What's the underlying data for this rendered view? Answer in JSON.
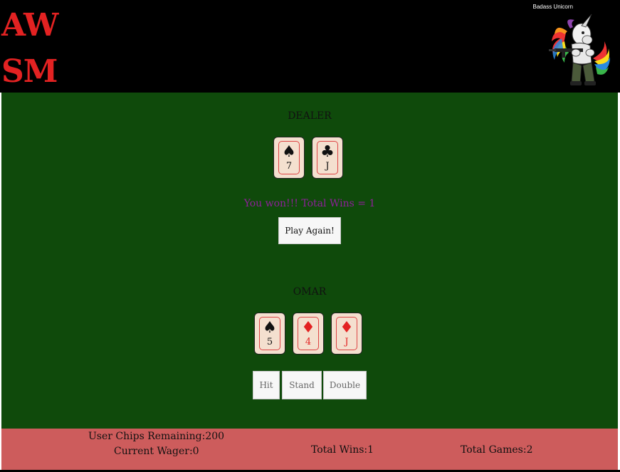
{
  "header": {
    "logo_line1": "AW",
    "logo_line2": "SM",
    "mascot_caption": "Badass Unicorn"
  },
  "dealer": {
    "label": "DEALER",
    "cards": [
      {
        "suit": "♠",
        "rank": "7",
        "color": "black"
      },
      {
        "suit": "♣",
        "rank": "J",
        "color": "black"
      }
    ]
  },
  "result": {
    "message": "You won!!! Total Wins = 1",
    "play_again_label": "Play Again!"
  },
  "player": {
    "label": "OMAR",
    "cards": [
      {
        "suit": "♠",
        "rank": "5",
        "color": "black"
      },
      {
        "suit": "♦",
        "rank": "4",
        "color": "red"
      },
      {
        "suit": "♦",
        "rank": "J",
        "color": "red"
      }
    ]
  },
  "actions": {
    "hit_label": "Hit",
    "stand_label": "Stand",
    "double_label": "Double"
  },
  "footer": {
    "chips": "User Chips Remaining:200",
    "wager": "Current Wager:0",
    "total_wins": "Total Wins:1",
    "total_games": "Total Games:2"
  },
  "colors": {
    "table_green": "#0f4a0b",
    "footer_red": "#cd5c5c",
    "logo_red": "#e32222",
    "result_purple": "#8f1f9a"
  }
}
